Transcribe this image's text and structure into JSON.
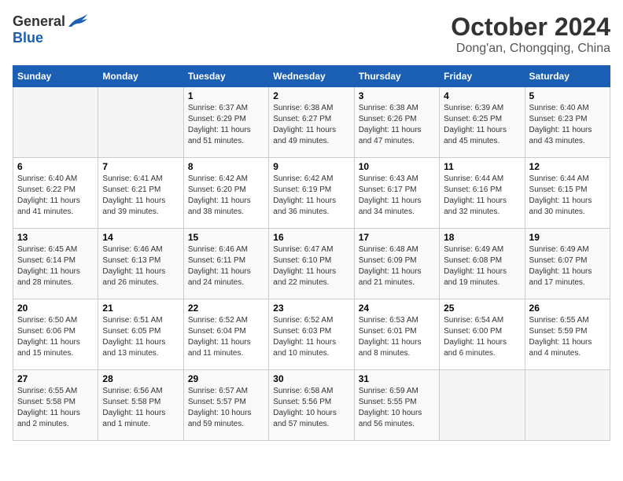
{
  "header": {
    "logo_general": "General",
    "logo_blue": "Blue",
    "month_title": "October 2024",
    "location": "Dong'an, Chongqing, China"
  },
  "weekdays": [
    "Sunday",
    "Monday",
    "Tuesday",
    "Wednesday",
    "Thursday",
    "Friday",
    "Saturday"
  ],
  "weeks": [
    [
      {
        "day": "",
        "info": ""
      },
      {
        "day": "",
        "info": ""
      },
      {
        "day": "1",
        "info": "Sunrise: 6:37 AM\nSunset: 6:29 PM\nDaylight: 11 hours and 51 minutes."
      },
      {
        "day": "2",
        "info": "Sunrise: 6:38 AM\nSunset: 6:27 PM\nDaylight: 11 hours and 49 minutes."
      },
      {
        "day": "3",
        "info": "Sunrise: 6:38 AM\nSunset: 6:26 PM\nDaylight: 11 hours and 47 minutes."
      },
      {
        "day": "4",
        "info": "Sunrise: 6:39 AM\nSunset: 6:25 PM\nDaylight: 11 hours and 45 minutes."
      },
      {
        "day": "5",
        "info": "Sunrise: 6:40 AM\nSunset: 6:23 PM\nDaylight: 11 hours and 43 minutes."
      }
    ],
    [
      {
        "day": "6",
        "info": "Sunrise: 6:40 AM\nSunset: 6:22 PM\nDaylight: 11 hours and 41 minutes."
      },
      {
        "day": "7",
        "info": "Sunrise: 6:41 AM\nSunset: 6:21 PM\nDaylight: 11 hours and 39 minutes."
      },
      {
        "day": "8",
        "info": "Sunrise: 6:42 AM\nSunset: 6:20 PM\nDaylight: 11 hours and 38 minutes."
      },
      {
        "day": "9",
        "info": "Sunrise: 6:42 AM\nSunset: 6:19 PM\nDaylight: 11 hours and 36 minutes."
      },
      {
        "day": "10",
        "info": "Sunrise: 6:43 AM\nSunset: 6:17 PM\nDaylight: 11 hours and 34 minutes."
      },
      {
        "day": "11",
        "info": "Sunrise: 6:44 AM\nSunset: 6:16 PM\nDaylight: 11 hours and 32 minutes."
      },
      {
        "day": "12",
        "info": "Sunrise: 6:44 AM\nSunset: 6:15 PM\nDaylight: 11 hours and 30 minutes."
      }
    ],
    [
      {
        "day": "13",
        "info": "Sunrise: 6:45 AM\nSunset: 6:14 PM\nDaylight: 11 hours and 28 minutes."
      },
      {
        "day": "14",
        "info": "Sunrise: 6:46 AM\nSunset: 6:13 PM\nDaylight: 11 hours and 26 minutes."
      },
      {
        "day": "15",
        "info": "Sunrise: 6:46 AM\nSunset: 6:11 PM\nDaylight: 11 hours and 24 minutes."
      },
      {
        "day": "16",
        "info": "Sunrise: 6:47 AM\nSunset: 6:10 PM\nDaylight: 11 hours and 22 minutes."
      },
      {
        "day": "17",
        "info": "Sunrise: 6:48 AM\nSunset: 6:09 PM\nDaylight: 11 hours and 21 minutes."
      },
      {
        "day": "18",
        "info": "Sunrise: 6:49 AM\nSunset: 6:08 PM\nDaylight: 11 hours and 19 minutes."
      },
      {
        "day": "19",
        "info": "Sunrise: 6:49 AM\nSunset: 6:07 PM\nDaylight: 11 hours and 17 minutes."
      }
    ],
    [
      {
        "day": "20",
        "info": "Sunrise: 6:50 AM\nSunset: 6:06 PM\nDaylight: 11 hours and 15 minutes."
      },
      {
        "day": "21",
        "info": "Sunrise: 6:51 AM\nSunset: 6:05 PM\nDaylight: 11 hours and 13 minutes."
      },
      {
        "day": "22",
        "info": "Sunrise: 6:52 AM\nSunset: 6:04 PM\nDaylight: 11 hours and 11 minutes."
      },
      {
        "day": "23",
        "info": "Sunrise: 6:52 AM\nSunset: 6:03 PM\nDaylight: 11 hours and 10 minutes."
      },
      {
        "day": "24",
        "info": "Sunrise: 6:53 AM\nSunset: 6:01 PM\nDaylight: 11 hours and 8 minutes."
      },
      {
        "day": "25",
        "info": "Sunrise: 6:54 AM\nSunset: 6:00 PM\nDaylight: 11 hours and 6 minutes."
      },
      {
        "day": "26",
        "info": "Sunrise: 6:55 AM\nSunset: 5:59 PM\nDaylight: 11 hours and 4 minutes."
      }
    ],
    [
      {
        "day": "27",
        "info": "Sunrise: 6:55 AM\nSunset: 5:58 PM\nDaylight: 11 hours and 2 minutes."
      },
      {
        "day": "28",
        "info": "Sunrise: 6:56 AM\nSunset: 5:58 PM\nDaylight: 11 hours and 1 minute."
      },
      {
        "day": "29",
        "info": "Sunrise: 6:57 AM\nSunset: 5:57 PM\nDaylight: 10 hours and 59 minutes."
      },
      {
        "day": "30",
        "info": "Sunrise: 6:58 AM\nSunset: 5:56 PM\nDaylight: 10 hours and 57 minutes."
      },
      {
        "day": "31",
        "info": "Sunrise: 6:59 AM\nSunset: 5:55 PM\nDaylight: 10 hours and 56 minutes."
      },
      {
        "day": "",
        "info": ""
      },
      {
        "day": "",
        "info": ""
      }
    ]
  ]
}
